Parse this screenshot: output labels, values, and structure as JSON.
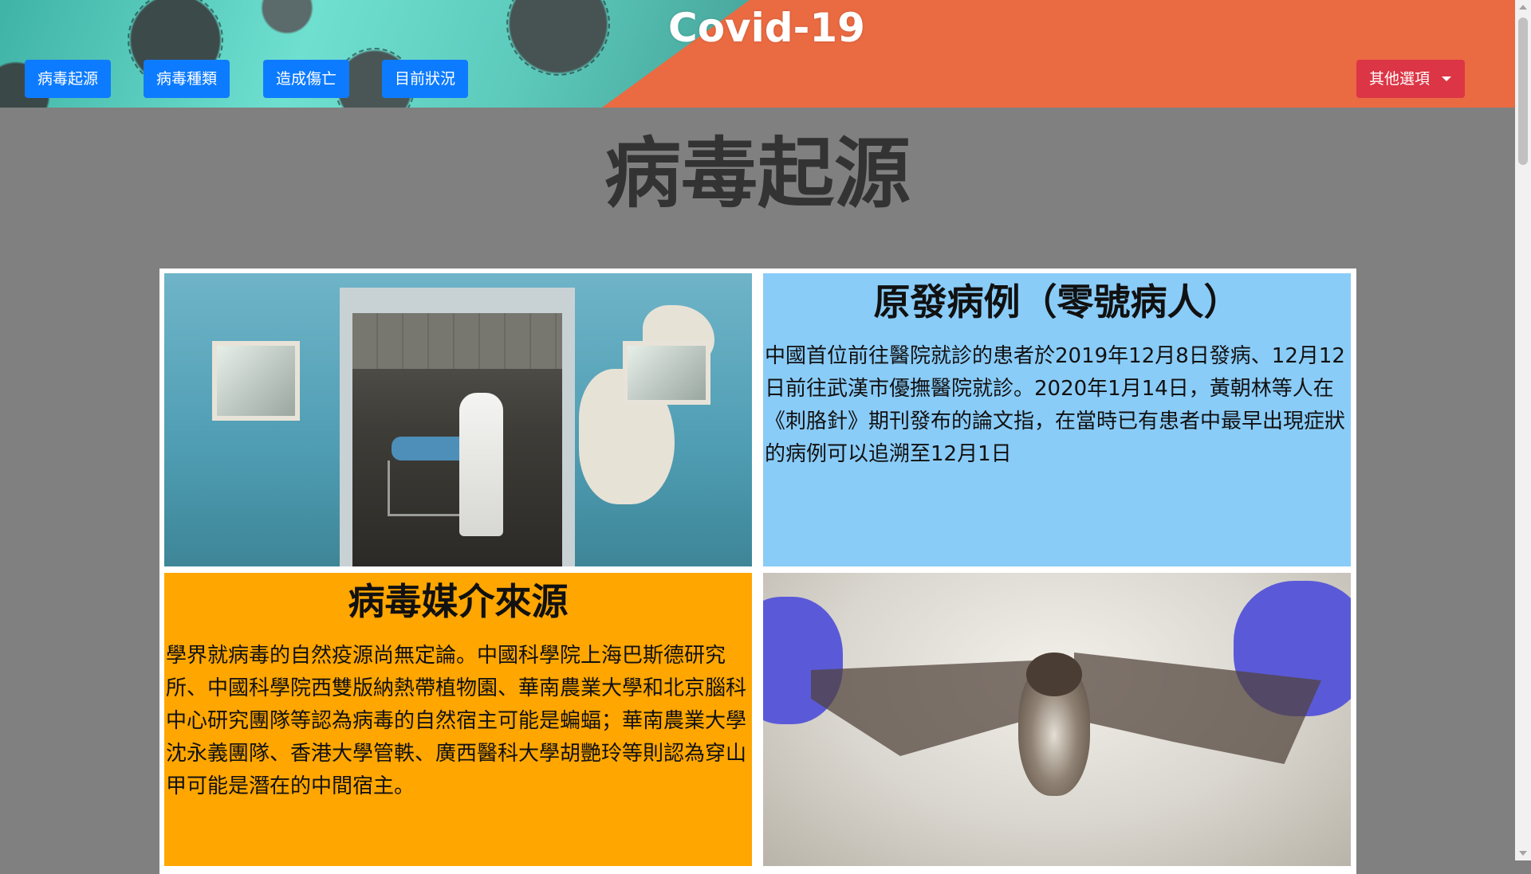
{
  "header": {
    "title": "Covid-19",
    "nav": [
      {
        "label": "病毒起源"
      },
      {
        "label": "病毒種類"
      },
      {
        "label": "造成傷亡"
      },
      {
        "label": "目前狀況"
      }
    ],
    "dropdown_label": "其他選項"
  },
  "page": {
    "title": "病毒起源"
  },
  "sections": {
    "patient_zero": {
      "heading": "原發病例（零號病人）",
      "body": "中國首位前往醫院就診的患者於2019年12月8日發病、12月12日前往武漢市優撫醫院就診。2020年1月14日，黃朝林等人在《刺胳針》期刊發布的論文指，在當時已有患者中最早出現症狀的病例可以追溯至12月1日"
    },
    "vector_source": {
      "heading": "病毒媒介來源",
      "body": "學界就病毒的自然疫源尚無定論。中國科學院上海巴斯德研究所、中國科學院西雙版納熱帶植物園、華南農業大學和北京腦科中心研究團隊等認為病毒的自然宿主可能是蝙蝠；華南農業大學沈永義團隊、香港大學管軼、廣西醫科大學胡艷玲等則認為穿山甲可能是潛在的中間宿主。"
    }
  },
  "colors": {
    "header_bg": "#ea6a42",
    "nav_button": "#0d7bff",
    "dropdown_button": "#dc3545",
    "page_bg": "#808080",
    "patient_zero_bg": "#8accf8",
    "vector_source_bg": "#ffa600"
  },
  "icons": {
    "dropdown": "caret-down-icon"
  }
}
